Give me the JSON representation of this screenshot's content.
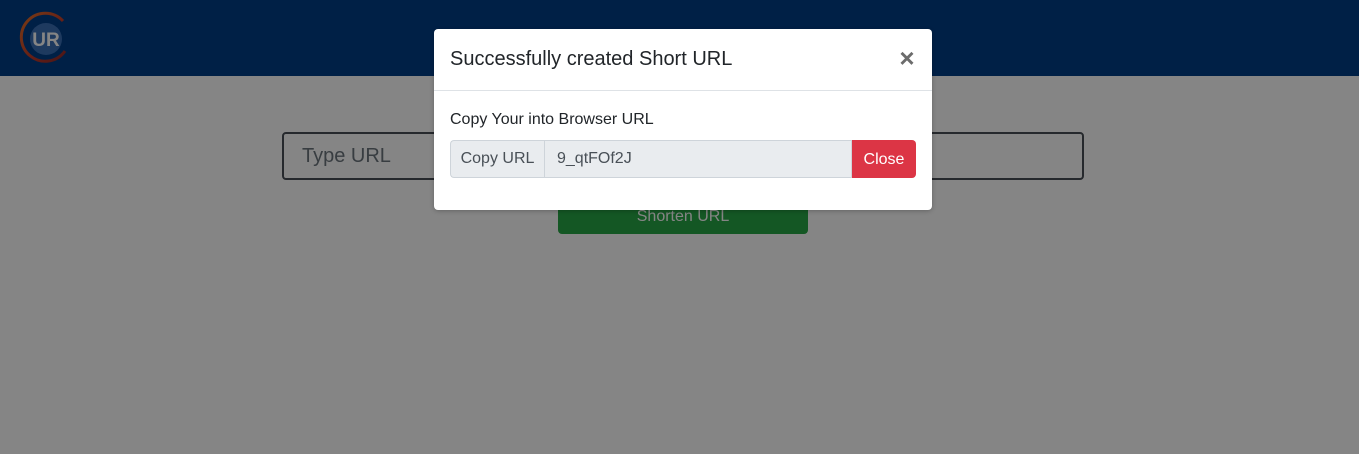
{
  "navbar": {
    "logo_text": "UR"
  },
  "main": {
    "url_input_placeholder": "Type URL",
    "shorten_button_label": "Shorten URL"
  },
  "modal": {
    "title": "Successfully created Short URL",
    "close_symbol": "×",
    "body_label": "Copy Your into Browser URL",
    "prepend_label": "Copy URL",
    "short_url_value": "9_qtFOf2J",
    "close_button_label": "Close"
  },
  "colors": {
    "navbar": "#003f87",
    "shorten_button": "#28a745",
    "close_button": "#dc3545",
    "logo_ring_orange": "#e8742a",
    "logo_ring_red": "#c0392b",
    "logo_circle": "#3b6fb6"
  }
}
